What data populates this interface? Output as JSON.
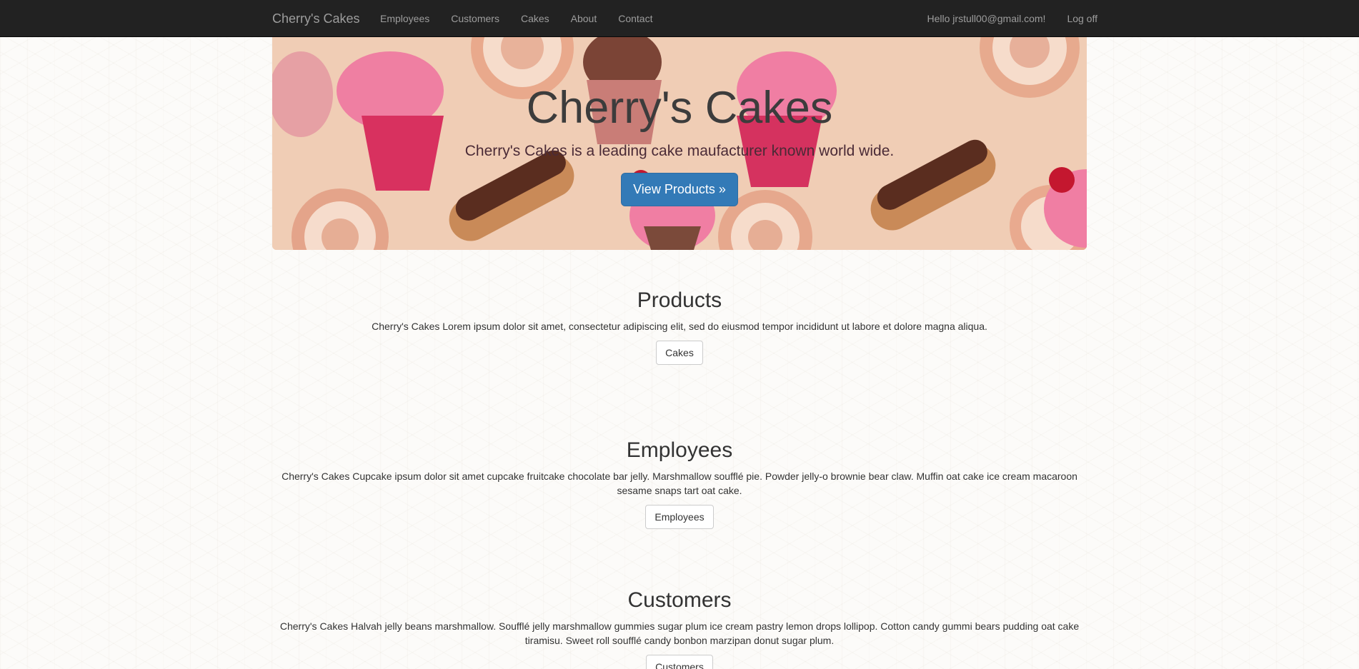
{
  "nav": {
    "brand": "Cherry's Cakes",
    "links": [
      "Employees",
      "Customers",
      "Cakes",
      "About",
      "Contact"
    ],
    "greeting": "Hello jrstull00@gmail.com!",
    "logoff": "Log off"
  },
  "hero": {
    "title": "Cherry's Cakes",
    "subtitle": "Cherry's Cakes is a leading cake maufacturer known world wide.",
    "button": "View Products »"
  },
  "sections": [
    {
      "title": "Products",
      "text": "Cherry's Cakes Lorem ipsum dolor sit amet, consectetur adipiscing elit, sed do eiusmod tempor incididunt ut labore et dolore magna aliqua.",
      "button": "Cakes"
    },
    {
      "title": "Employees",
      "text": "Cherry's Cakes Cupcake ipsum dolor sit amet cupcake fruitcake chocolate bar jelly. Marshmallow soufflé pie. Powder jelly-o brownie bear claw. Muffin oat cake ice cream macaroon sesame snaps tart oat cake.",
      "button": "Employees"
    },
    {
      "title": "Customers",
      "text": "Cherry's Cakes Halvah jelly beans marshmallow. Soufflé jelly marshmallow gummies sugar plum ice cream pastry lemon drops lollipop. Cotton candy gummi bears pudding oat cake tiramisu. Sweet roll soufflé candy bonbon marzipan donut sugar plum.",
      "button": "Customers"
    }
  ],
  "colors": {
    "navbar": "#222222",
    "nav_text": "#9d9d9d",
    "primary": "#337ab7",
    "hero_bg": "#f1cdb4"
  }
}
